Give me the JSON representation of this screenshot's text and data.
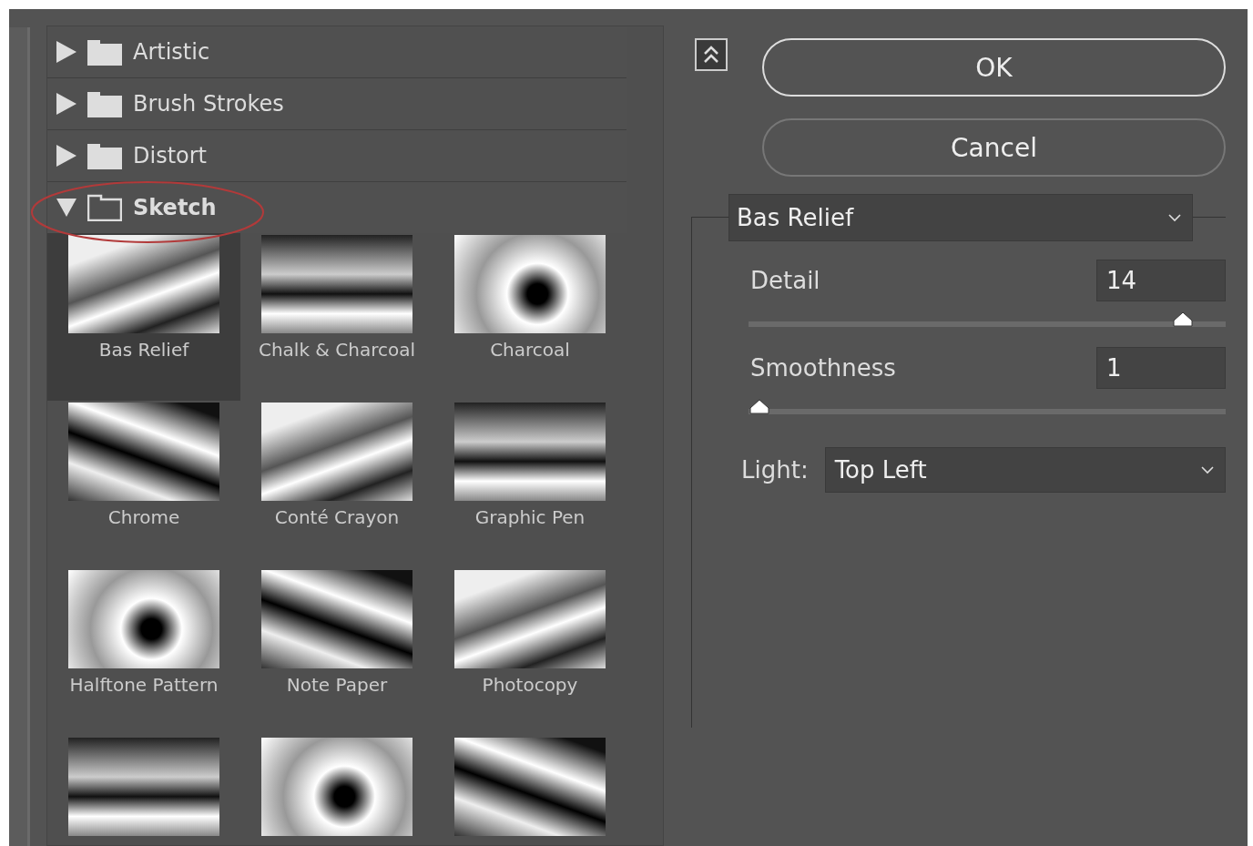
{
  "categories": [
    {
      "label": "Artistic",
      "expanded": false
    },
    {
      "label": "Brush Strokes",
      "expanded": false
    },
    {
      "label": "Distort",
      "expanded": false
    },
    {
      "label": "Sketch",
      "expanded": true,
      "filters": [
        {
          "label": "Bas Relief",
          "selected": true
        },
        {
          "label": "Chalk & Charcoal",
          "selected": false
        },
        {
          "label": "Charcoal",
          "selected": false
        },
        {
          "label": "Chrome",
          "selected": false
        },
        {
          "label": "Conté Crayon",
          "selected": false
        },
        {
          "label": "Graphic Pen",
          "selected": false
        },
        {
          "label": "Halftone Pattern",
          "selected": false
        },
        {
          "label": "Note Paper",
          "selected": false
        },
        {
          "label": "Photocopy",
          "selected": false
        },
        {
          "selected": false
        },
        {
          "selected": false
        },
        {
          "selected": false
        }
      ]
    }
  ],
  "buttons": {
    "ok": "OK",
    "cancel": "Cancel"
  },
  "filter_select": {
    "value": "Bas Relief"
  },
  "params": [
    {
      "label": "Detail",
      "value": "14",
      "level": 0.93
    },
    {
      "label": "Smoothness",
      "value": "1",
      "level": 0.0
    }
  ],
  "light": {
    "label": "Light:",
    "value": "Top Left"
  }
}
